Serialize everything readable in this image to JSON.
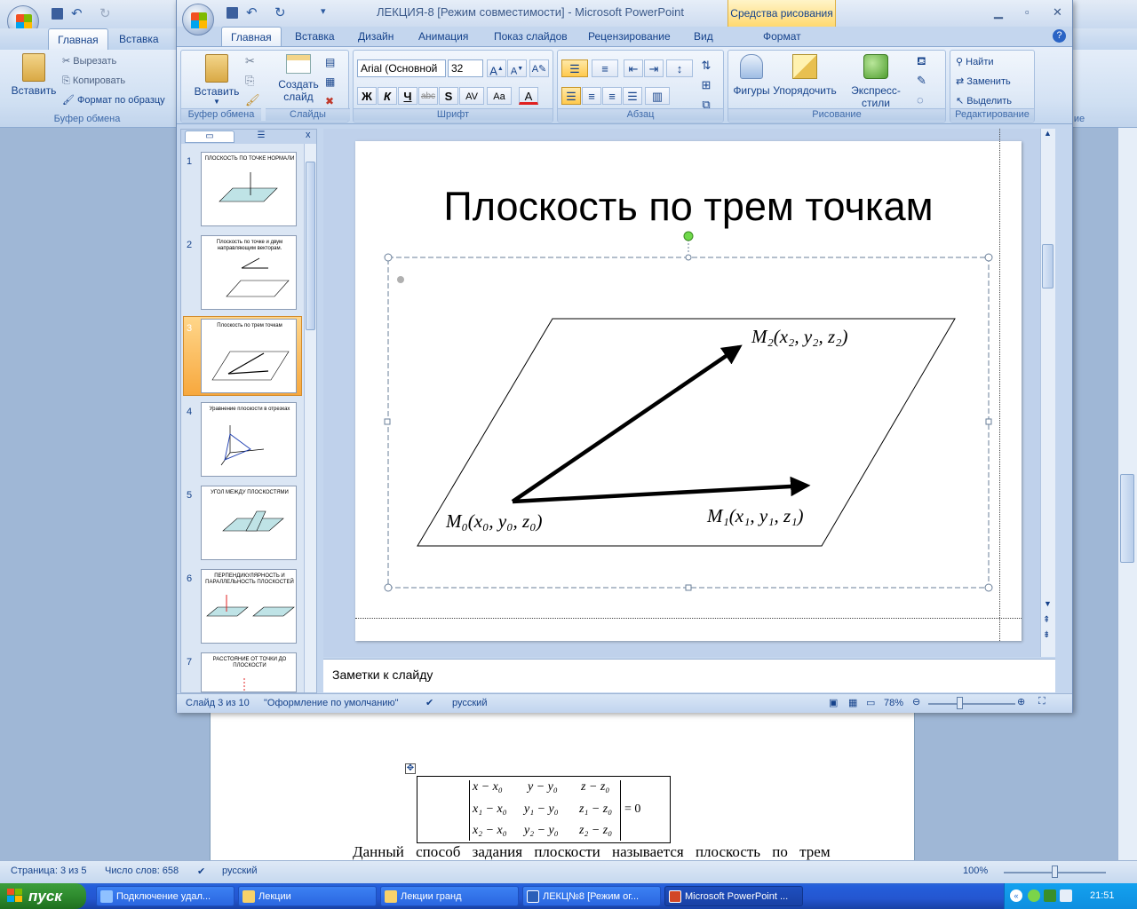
{
  "word": {
    "tabs": [
      "Главная",
      "Вставка"
    ],
    "clipboard": {
      "paste": "Вставить",
      "cut": "Вырезать",
      "copy": "Копировать",
      "format_painter": "Формат по образцу",
      "group": "Буфер обмена"
    },
    "right_tab_partial": "ие",
    "formula": {
      "rows": [
        [
          "x − x₀",
          "y − y₀",
          "z − z₀"
        ],
        [
          "x₁ − x₀",
          "y₁ − y₀",
          "z₁ − z₀"
        ],
        [
          "x₂ − x₀",
          "y₂ − y₀",
          "z₂ − z₀"
        ]
      ],
      "equals": "= 0"
    },
    "doc_text": "Данный способ задания плоскости называется плоскость по трем",
    "status": {
      "page": "Страница: 3 из 5",
      "words": "Число слов: 658",
      "lang": "русский",
      "zoom": "100%"
    }
  },
  "ppt": {
    "title": "ЛЕКЦИЯ-8 [Режим совместимости] - Microsoft PowerPoint",
    "context_tab": "Средства рисования",
    "tabs": [
      "Главная",
      "Вставка",
      "Дизайн",
      "Анимация",
      "Показ слайдов",
      "Рецензирование",
      "Вид",
      "Формат"
    ],
    "ribbon": {
      "clipboard_paste": "Вставить",
      "clipboard_group": "Буфер обмена",
      "slides_new1": "Создать",
      "slides_new2": "слайд",
      "slides_group": "Слайды",
      "font_name": "Arial (Основной",
      "font_size": "32",
      "font_group": "Шрифт",
      "para_group": "Абзац",
      "draw_shapes": "Фигуры",
      "draw_arrange": "Упорядочить",
      "draw_styles": "Экспресс-стили",
      "draw_group": "Рисование",
      "edit_find": "Найти",
      "edit_replace": "Заменить",
      "edit_select": "Выделить",
      "edit_group": "Редактирование"
    },
    "thumbnails": [
      {
        "num": "1",
        "title": "ПЛОСКОСТЬ ПО ТОЧКЕ НОРМАЛИ"
      },
      {
        "num": "2",
        "title": "Плоскость по точке и двум направляющим векторам."
      },
      {
        "num": "3",
        "title": "Плоскость по трем точкам"
      },
      {
        "num": "4",
        "title": "Уравнение плоскости в отрезках"
      },
      {
        "num": "5",
        "title": "УГОЛ МЕЖДУ ПЛОСКОСТЯМИ"
      },
      {
        "num": "6",
        "title": "ПЕРПЕНДИКУЛЯРНОСТЬ И ПАРАЛЛЕЛЬНОСТЬ ПЛОСКОСТЕЙ"
      },
      {
        "num": "7",
        "title": "РАССТОЯНИЕ ОТ ТОЧКИ ДО ПЛОСКОСТИ"
      }
    ],
    "slide": {
      "title": "Плоскость по трем точкам",
      "m0": "M₀(x₀, y₀, z₀)",
      "m1": "M₁(x₁, y₁, z₁)",
      "m2": "M₂(x₂, y₂, z₂)"
    },
    "notes_placeholder": "Заметки к слайду",
    "status": {
      "slide": "Слайд 3 из 10",
      "theme": "\"Оформление по умолчанию\"",
      "lang": "русский",
      "zoom": "78%"
    }
  },
  "taskbar": {
    "start": "пуск",
    "items": [
      "Подключение удал...",
      "Лекции",
      "Лекции гранд",
      "ЛЕКЦ№8 [Режим ог...",
      "Microsoft PowerPoint ..."
    ],
    "lang": "RU",
    "time": "21:51"
  }
}
